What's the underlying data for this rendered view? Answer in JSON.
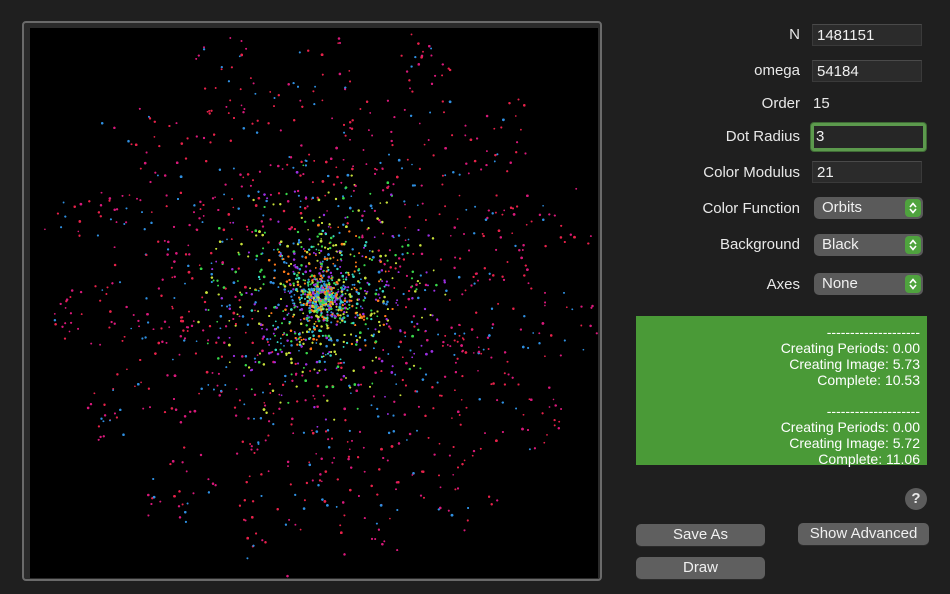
{
  "params": {
    "n_label": "N",
    "n_value": "1481151",
    "omega_label": "omega",
    "omega_value": "54184",
    "order_label": "Order",
    "order_value": "15",
    "dot_radius_label": "Dot Radius",
    "dot_radius_value": "3",
    "color_modulus_label": "Color Modulus",
    "color_modulus_value": "21",
    "color_function_label": "Color Function",
    "color_function_value": "Orbits",
    "background_label": "Background",
    "background_value": "Black",
    "axes_label": "Axes",
    "axes_value": "None"
  },
  "console": {
    "lines": [
      "--------------------",
      "Creating Periods: 0.00",
      "Creating Image: 5.73",
      "Complete: 10.53",
      "",
      "--------------------",
      "Creating Periods: 0.00",
      "Creating Image: 5.72",
      "Complete: 11.06"
    ]
  },
  "buttons": {
    "help": "?",
    "save_as": "Save As",
    "show_advanced": "Show Advanced",
    "draw": "Draw"
  },
  "colors": {
    "console_bg": "#4a9a37",
    "focus_ring": "#5c9a4d",
    "stepper": "#4fa33e",
    "dot_palette": [
      "#e6224a",
      "#d7197a",
      "#2f8fe0",
      "#9a2fe0",
      "#39d64a",
      "#c7e03a",
      "#ff7a1a",
      "#36d6c2"
    ]
  }
}
